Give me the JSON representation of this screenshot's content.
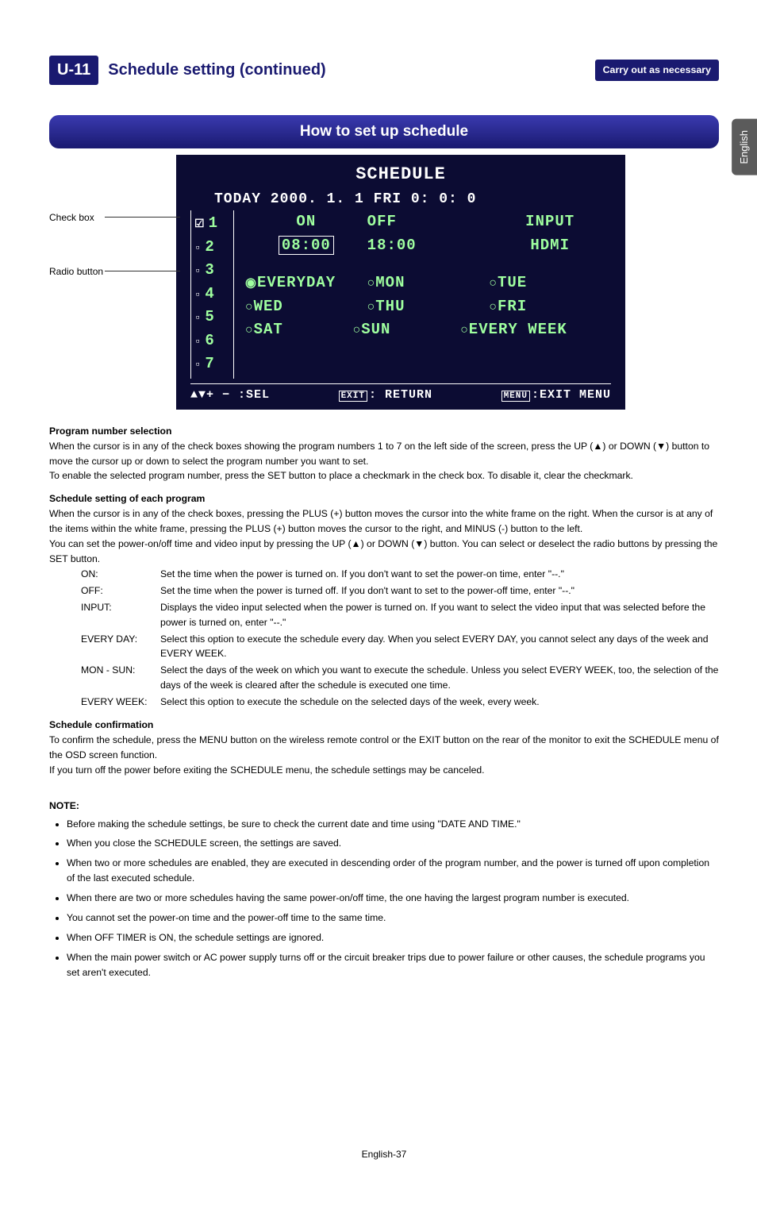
{
  "side_tab": "English",
  "header": {
    "section_number": "U-11",
    "title": "Schedule setting (continued)",
    "badge": "Carry out as necessary"
  },
  "section_bar": "How to set up schedule",
  "callouts": {
    "check_box": "Check box",
    "radio_button": "Radio button"
  },
  "osd": {
    "title": "SCHEDULE",
    "today_line": "TODAY    2000. 1. 1 FRI   0: 0: 0",
    "programs": [
      "1",
      "2",
      "3",
      "4",
      "5",
      "6",
      "7"
    ],
    "checked_index": 0,
    "columns": {
      "on": "ON",
      "off": "OFF",
      "input": "INPUT"
    },
    "values": {
      "on": "08:00",
      "off": "18:00",
      "input": "HDMI"
    },
    "days_row1": [
      "EVERYDAY",
      "MON",
      "TUE"
    ],
    "days_row2": [
      "WED",
      "THU",
      "FRI"
    ],
    "days_row3": [
      "SAT",
      "SUN",
      "EVERY WEEK"
    ],
    "selected_day": "EVERYDAY",
    "foot_sel": "▲▼+ − :SEL",
    "foot_return_key": "EXIT",
    "foot_return": ": RETURN",
    "foot_exit_key": "MENU",
    "foot_exit": ":EXIT MENU"
  },
  "body": {
    "h1": "Program number selection",
    "p1a": "When the cursor is in any of the check boxes showing the program numbers 1 to 7 on the left side of the screen, press the UP (▲) or DOWN (▼) button to move the cursor up or down to select the program number you want to set.",
    "p1b": "To enable the selected program number, press the SET button to place a checkmark in the check box. To disable it, clear the checkmark.",
    "h2": "Schedule setting of each program",
    "p2a": "When the cursor is in any of the check boxes, pressing the PLUS (+) button moves the cursor into the white frame on the right. When the cursor is at any of the items within the white frame, pressing the PLUS (+) button moves the cursor to the right, and MINUS (-) button to the left.",
    "p2b": "You can set the power-on/off time and video input by pressing the UP (▲) or DOWN (▼) button. You can select or deselect the radio buttons by pressing the SET button.",
    "defs": [
      {
        "t": "ON:",
        "d": "Set the time when the power is turned on. If you don't want to set the power-on time, enter \"--.\""
      },
      {
        "t": "OFF:",
        "d": "Set the time when the power is turned off. If you don't want to set to the power-off time, enter \"--.\""
      },
      {
        "t": "INPUT:",
        "d": "Displays the video input selected when the power is turned on. If you want to select the video input that was selected before the power is turned on, enter \"--.\""
      },
      {
        "t": "EVERY DAY:",
        "d": "Select this option to execute the schedule every day. When you select EVERY DAY, you cannot select any days of the week and EVERY WEEK."
      },
      {
        "t": "MON - SUN:",
        "d": "Select the days of the week on which you want to execute the schedule. Unless you select EVERY WEEK, too, the selection of the days of the week is cleared after the schedule is executed one time."
      },
      {
        "t": "EVERY WEEK:",
        "d": "Select this option to execute the schedule on the selected days of the week, every week."
      }
    ],
    "h3": "Schedule confirmation",
    "p3a": "To confirm the schedule, press the MENU button on the wireless remote control or the EXIT button on the rear of the monitor to exit the SCHEDULE menu of the OSD screen function.",
    "p3b": "If you turn off the power before exiting the SCHEDULE menu, the schedule settings may be canceled.",
    "note_h": "NOTE:",
    "notes": [
      "Before making the schedule settings, be sure to check the current date and time using \"DATE AND TIME.\"",
      "When you close the SCHEDULE screen, the settings are saved.",
      "When two or more schedules are enabled, they are executed in descending order of the program number, and the power is turned off upon completion of the last executed schedule.",
      "When there are two or more schedules having the same power-on/off time, the one having the largest program number is executed.",
      "You cannot set the power-on time and the power-off time to the same time.",
      "When OFF TIMER is ON, the schedule settings are ignored.",
      "When the main power switch or AC power supply turns off or the circuit breaker trips due to power failure or other causes, the schedule programs you set aren't executed."
    ]
  },
  "page_number": "English-37"
}
